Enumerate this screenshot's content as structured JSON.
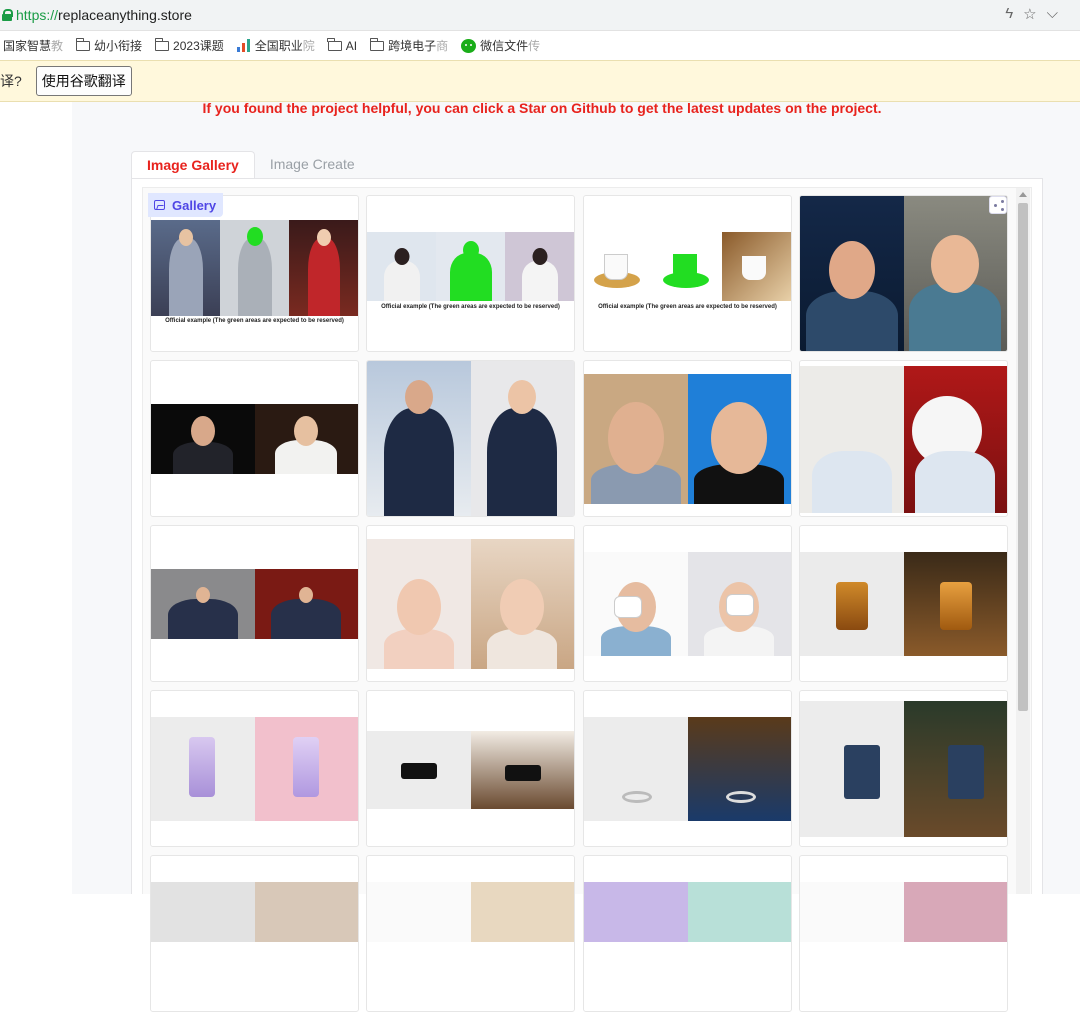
{
  "browser": {
    "url_scheme": "https://",
    "url_host": "replaceanything.store",
    "bookmarks": [
      {
        "label": "国家智慧",
        "fade": "教",
        "icon": "none"
      },
      {
        "label": "幼小衔接",
        "fade": "",
        "icon": "folder"
      },
      {
        "label": "2023课题",
        "fade": "",
        "icon": "folder"
      },
      {
        "label": "全国职业",
        "fade": "院",
        "icon": "chart"
      },
      {
        "label": "AI",
        "fade": "",
        "icon": "folder"
      },
      {
        "label": "跨境电子",
        "fade": "商",
        "icon": "folder"
      },
      {
        "label": "微信文件",
        "fade": "传",
        "icon": "wechat"
      }
    ],
    "translate_question": "译?",
    "translate_button": "使用谷歌翻译"
  },
  "page": {
    "notice": "If you found the project helpful, you can click a Star on Github to get the latest updates on the project.",
    "tabs": [
      {
        "label": "Image Gallery",
        "active": true
      },
      {
        "label": "Image Create",
        "active": false
      }
    ],
    "gallery_label": "Gallery",
    "official_caption": "Official example (The green areas are expected to be reserved)"
  },
  "colors": {
    "accent_red": "#e8231d",
    "gallery_label_bg": "#e0e7ff",
    "gallery_label_text": "#4f46e5",
    "mask_green": "#22dd22"
  }
}
